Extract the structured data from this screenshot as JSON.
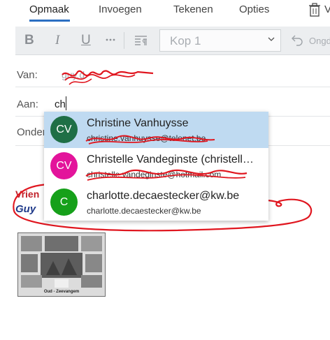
{
  "tabs": [
    {
      "label": "Opmaak",
      "active": true
    },
    {
      "label": "Invoegen",
      "active": false
    },
    {
      "label": "Tekenen",
      "active": false
    },
    {
      "label": "Opties",
      "active": false
    }
  ],
  "toolbar": {
    "bold": "B",
    "italic": "I",
    "underline": "U",
    "heading_style": "Kop 1",
    "undo_label": "Ongd"
  },
  "from": {
    "label": "Van:",
    "value": "guy.d"
  },
  "to": {
    "label": "Aan:",
    "value": "ch"
  },
  "subject": {
    "label": "Onder"
  },
  "suggestions": [
    {
      "initials": "CV",
      "name": "Christine Vanhuysse",
      "email": "christine.vanhuysse@telenet.be",
      "avatar_color": "#1f6f46",
      "selected": true
    },
    {
      "initials": "CV",
      "name": "Christelle Vandeginste (christell…",
      "email": "christelle.vandeginste@hotmail.com",
      "avatar_color": "#e3149b",
      "selected": false
    },
    {
      "initials": "C",
      "name": "charlotte.decaestecker@kw.be",
      "email": "charlotte.decaestecker@kw.be",
      "avatar_color": "#16a01a",
      "selected": false
    }
  ],
  "body": {
    "greeting": "Vrien",
    "signature": "Guy",
    "postcard_caption": "Oud - Zeevangem"
  },
  "colors": {
    "accent": "#2b6fc2",
    "annotation": "#e0161f"
  }
}
